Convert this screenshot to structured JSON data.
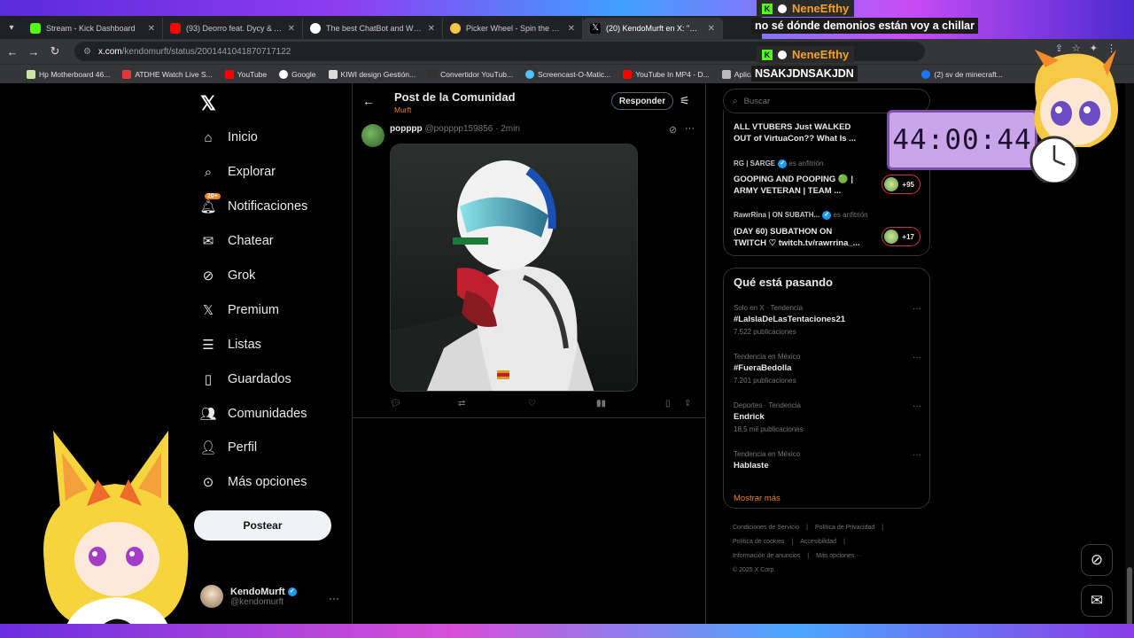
{
  "browser": {
    "tabs": [
      {
        "title": "Stream - Kick Dashboard",
        "color": "#53fc18"
      },
      {
        "title": "(93) Deorro feat. Dycy & Adrian",
        "color": "#ff0000"
      },
      {
        "title": "The best ChatBot and Widgets",
        "color": "#ffffff"
      },
      {
        "title": "Picker Wheel - Spin the Wheel",
        "color": "#f6c64b"
      },
      {
        "title": "(20) KendoMurft en X: \"Ando a",
        "color": "#000000",
        "active": true
      }
    ],
    "url_host": "x.com",
    "url_path": "/kendomurft/status/2001441041870717122",
    "bookmarks": [
      "Hp Motherboard 46...",
      "ATDHE Watch Live S...",
      "YouTube",
      "Google",
      "KIWI design Gestión...",
      "Convertidor YouTub...",
      "Screencast-O-Matic...",
      "YouTube In MP4 - D...",
      "Aplicaciones",
      "(2) sv de minecraft..."
    ]
  },
  "nav": {
    "items": [
      {
        "label": "Inicio",
        "icon": "home-icon"
      },
      {
        "label": "Explorar",
        "icon": "search-icon"
      },
      {
        "label": "Notificaciones",
        "icon": "bell-icon",
        "badge": "20+"
      },
      {
        "label": "Chatear",
        "icon": "mail-icon"
      },
      {
        "label": "Grok",
        "icon": "grok-icon"
      },
      {
        "label": "Premium",
        "icon": "x-icon"
      },
      {
        "label": "Listas",
        "icon": "list-icon"
      },
      {
        "label": "Guardados",
        "icon": "bookmark-icon"
      },
      {
        "label": "Comunidades",
        "icon": "people-icon"
      },
      {
        "label": "Perfil",
        "icon": "person-icon"
      },
      {
        "label": "Más opciones",
        "icon": "more-circle-icon"
      }
    ],
    "post_label": "Postear",
    "user": {
      "name": "KendoMurft",
      "handle": "@kendomurft"
    }
  },
  "main": {
    "title": "Post de la Comunidad",
    "subtitle": "Murft",
    "reply_label": "Responder",
    "tweet": {
      "name": "popppp",
      "handle": "@popppp159856",
      "sep": "·",
      "time": "2min",
      "views": "6"
    }
  },
  "right": {
    "search_placeholder": "Buscar",
    "spaces": [
      {
        "title": "ALL VTUBERS Just WALKED OUT of VirtuaCon?? What Is ..."
      },
      {
        "host": "RG | SARGE",
        "host_suffix": "es anfitrión",
        "title": "GOOPING AND POOPING 🟢 | ARMY VETERAN | TEAM ...",
        "count": "+95"
      },
      {
        "host": "RawrRina | ON SUBATH...",
        "host_suffix": "es anfitrión",
        "title": "(DAY 60) SUBATHON ON TWITCH ♡ twitch.tv/rawrrina_...",
        "count": "+17"
      }
    ],
    "trends_title": "Qué está pasando",
    "trends": [
      {
        "category": "Solo en X · Tendencia",
        "name": "#LaIslaDeLasTentaciones21",
        "posts": "7.522 publicaciones"
      },
      {
        "category": "Tendencia en México",
        "name": "#FueraBedolla",
        "posts": "7.201 publicaciones"
      },
      {
        "category": "Deportes · Tendencia",
        "name": "Endrick",
        "posts": "18,5 mil publicaciones"
      },
      {
        "category": "Tendencia en México",
        "name": "Hablaste",
        "posts": ""
      }
    ],
    "show_more": "Mostrar más",
    "footer": [
      "Condiciones de Servicio",
      "Política de Privacidad",
      "Política de cookies",
      "Accesibilidad",
      "Información de anuncios",
      "Más opciones ···",
      "© 2025 X Corp."
    ]
  },
  "overlay": {
    "chat": [
      {
        "user": "NeneEfthy",
        "message": "no sé dónde demonios están voy a chillar"
      },
      {
        "user": "NeneEfthy",
        "message": "NSAKJDNSAKJDN"
      }
    ],
    "timer": "44:00:44"
  },
  "colors": {
    "accent": "#f4811f",
    "verified": "#1d9bf0",
    "kick": "#53fc18"
  }
}
